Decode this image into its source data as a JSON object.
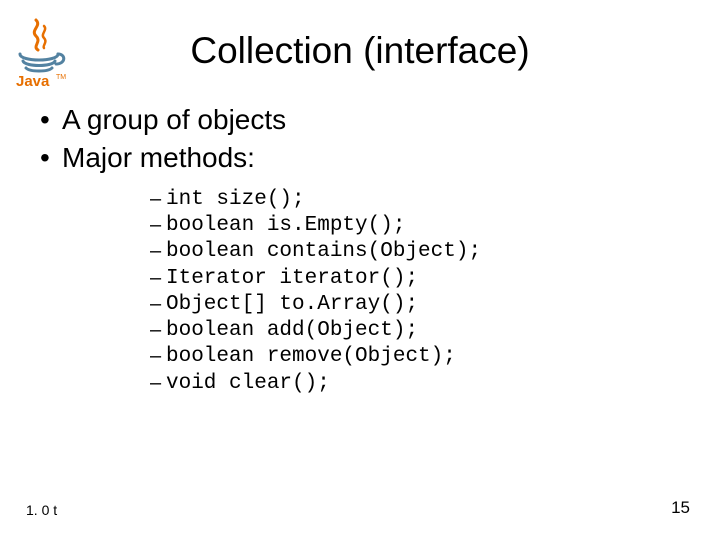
{
  "title": "Collection (interface)",
  "logo": {
    "alt": "Java logo",
    "wordmark": "Java"
  },
  "bullets": {
    "b0": "A group of objects",
    "b1": "Major methods:"
  },
  "methods": {
    "m0": "int size();",
    "m1": "boolean is.Empty();",
    "m2": "boolean contains(Object);",
    "m3": "Iterator iterator();",
    "m4": "Object[] to.Array();",
    "m5": "boolean add(Object);",
    "m6": "boolean remove(Object);",
    "m7": "void clear();"
  },
  "footer": {
    "left": "1. 0 t",
    "right": "15"
  }
}
